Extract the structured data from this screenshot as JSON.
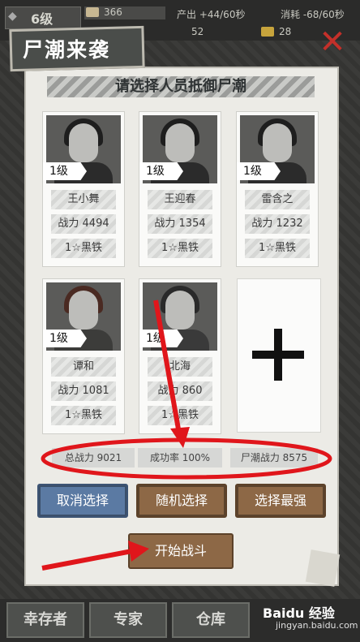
{
  "topbar": {
    "level": "6级",
    "resource1": "366",
    "produce": "产出 +44/60秒",
    "consume": "消耗 -68/60秒",
    "resource2": "52",
    "resource3": "28"
  },
  "title": "尸潮来袭",
  "subtitle": "请选择人员抵御尸潮",
  "cards": [
    {
      "level": "1级",
      "name": "王小舞",
      "power": "战力 4494",
      "rank": "1☆黑铁"
    },
    {
      "level": "1级",
      "name": "王迎春",
      "power": "战力 1354",
      "rank": "1☆黑铁"
    },
    {
      "level": "1级",
      "name": "雷含之",
      "power": "战力 1232",
      "rank": "1☆黑铁"
    },
    {
      "level": "1级",
      "name": "谭和",
      "power": "战力 1081",
      "rank": "1☆黑铁"
    },
    {
      "level": "1级",
      "name": "北海",
      "power": "战力 860",
      "rank": "1☆黑铁"
    }
  ],
  "stats": {
    "total_power": "总战力 9021",
    "success_rate": "成功率 100%",
    "horde_power": "尸潮战力 8575"
  },
  "buttons": {
    "cancel": "取消选择",
    "random": "随机选择",
    "strongest": "选择最强",
    "start": "开始战斗"
  },
  "bottom_nav": [
    "幸存者",
    "专家",
    "仓库"
  ],
  "watermark": {
    "brand": "Baidu 经验",
    "url": "jingyan.baidu.com"
  },
  "colors": {
    "annotation": "#e0161b",
    "accent_blue": "#5b7aa3",
    "accent_brown": "#8d6846"
  },
  "icons": [
    "close-icon",
    "plus-icon",
    "level-icon",
    "resource-icon"
  ]
}
